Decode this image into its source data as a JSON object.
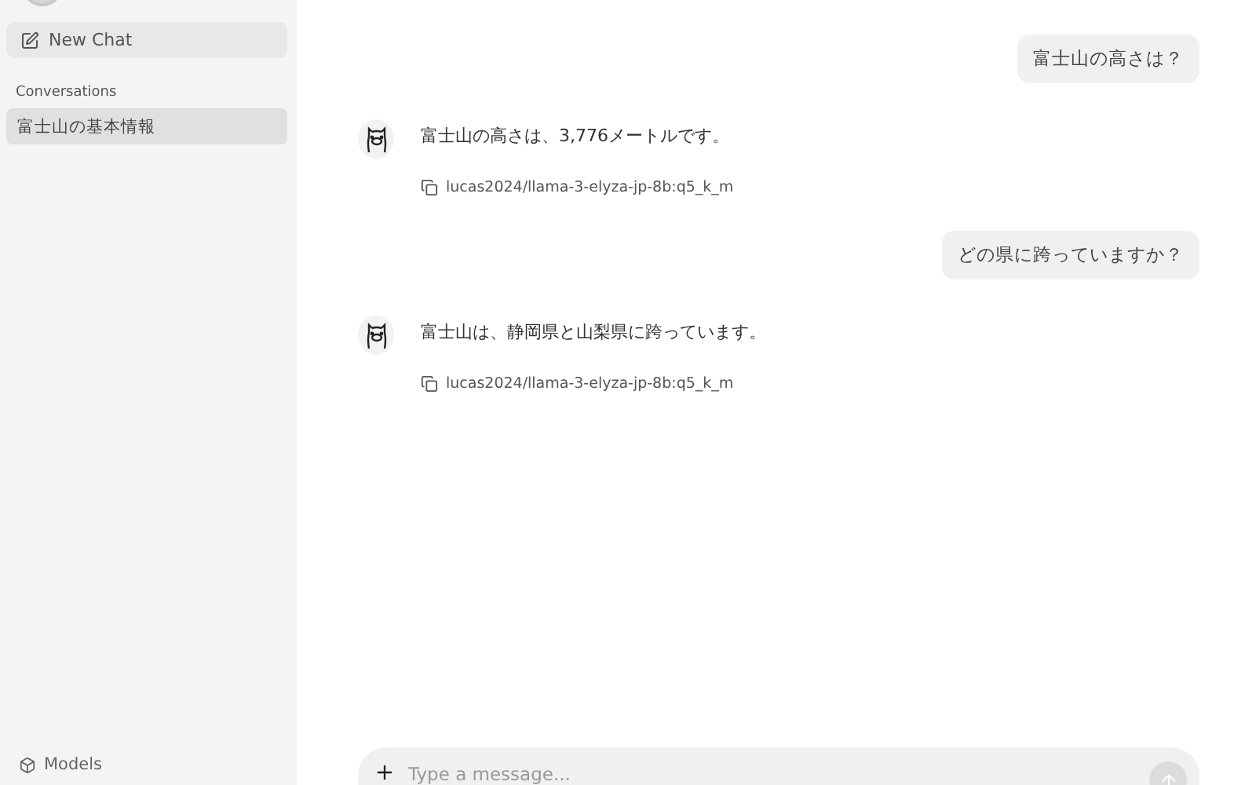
{
  "sidebar": {
    "new_chat": "New Chat",
    "section_title": "Conversations",
    "conversations": [
      {
        "title": "富士山の基本情報",
        "selected": true
      }
    ],
    "models_link": "Models"
  },
  "messages": [
    {
      "kind": "user",
      "text": "富士山の高さは？"
    },
    {
      "kind": "assistant",
      "text": "富士山の高さは、3,776メートルです。",
      "model": "lucas2024/llama-3-elyza-jp-8b:q5_k_m"
    },
    {
      "kind": "user",
      "text": "どの県に跨っていますか？"
    },
    {
      "kind": "assistant",
      "text": "富士山は、静岡県と山梨県に跨っています。",
      "model": "lucas2024/llama-3-elyza-jp-8b:q5_k_m"
    }
  ],
  "composer": {
    "placeholder": "Type a message..."
  }
}
